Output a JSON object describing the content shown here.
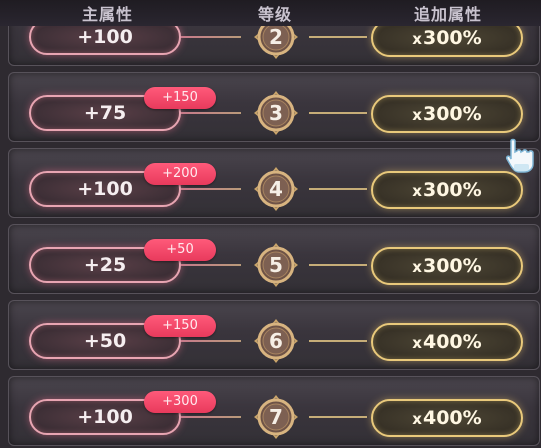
{
  "header": {
    "main_attr": "主属性",
    "level": "等级",
    "extra_attr": "追加属性"
  },
  "rows": [
    {
      "main": "+100",
      "bonus": "",
      "level": "2",
      "multiplier": "300%"
    },
    {
      "main": "+75",
      "bonus": "+150",
      "level": "3",
      "multiplier": "300%"
    },
    {
      "main": "+100",
      "bonus": "+200",
      "level": "4",
      "multiplier": "300%"
    },
    {
      "main": "+25",
      "bonus": "+50",
      "level": "5",
      "multiplier": "300%"
    },
    {
      "main": "+50",
      "bonus": "+150",
      "level": "6",
      "multiplier": "400%"
    },
    {
      "main": "+100",
      "bonus": "+300",
      "level": "7",
      "multiplier": "400%"
    }
  ],
  "multiplier_prefix": "x",
  "colors": {
    "main_pill_border": "#e8a5b2",
    "bonus_badge": "#f04a6c",
    "extra_pill_border": "#e9c97b",
    "row_bg": "#3e3a41"
  },
  "icons": {
    "cursor": "pointing-hand-cursor-icon",
    "level_frame": "ornate-level-frame-icon"
  }
}
